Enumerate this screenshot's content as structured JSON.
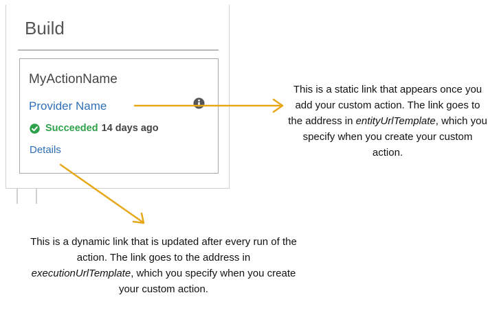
{
  "stage": {
    "title": "Build"
  },
  "action": {
    "name": "MyActionName",
    "provider_link": "Provider Name",
    "status": "Succeeded",
    "time": "14 days ago",
    "details_link": "Details"
  },
  "annotations": {
    "static_link": {
      "before": "This is a static link that appears once you add your custom action. The link goes to the address in ",
      "field": "entityUrlTemplate",
      "after": ", which you specify when you create your custom action."
    },
    "dynamic_link": {
      "before": "This is a dynamic link that is updated after every run of the action. The link goes to the address in ",
      "field": "executionUrlTemplate",
      "after": ", which you specify when you create your custom action."
    }
  },
  "colors": {
    "link": "#2f6fb8",
    "success": "#2ea24a",
    "arrow": "#e6a817"
  },
  "icons": {
    "info": "info-circle-icon",
    "status": "check-circle-icon"
  }
}
